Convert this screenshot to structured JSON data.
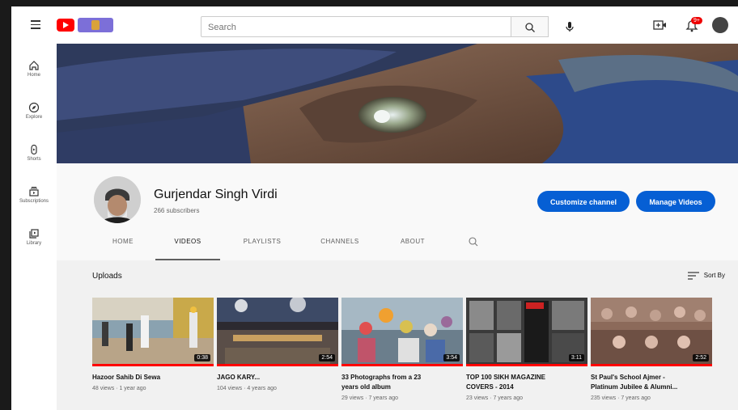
{
  "topbar": {
    "search_placeholder": "Search",
    "notification_count": "9+"
  },
  "sidebar": {
    "items": [
      {
        "label": "Home",
        "icon": "home-icon"
      },
      {
        "label": "Explore",
        "icon": "compass-icon"
      },
      {
        "label": "Shorts",
        "icon": "shorts-icon"
      },
      {
        "label": "Subscriptions",
        "icon": "subscriptions-icon"
      },
      {
        "label": "Library",
        "icon": "library-icon"
      }
    ]
  },
  "channel": {
    "name": "Gurjendar Singh Virdi",
    "subscribers": "266 subscribers",
    "customize_label": "Customize channel",
    "manage_label": "Manage Videos"
  },
  "tabs": [
    {
      "label": "HOME",
      "active": false
    },
    {
      "label": "VIDEOS",
      "active": true
    },
    {
      "label": "PLAYLISTS",
      "active": false
    },
    {
      "label": "CHANNELS",
      "active": false
    },
    {
      "label": "ABOUT",
      "active": false
    }
  ],
  "content": {
    "section_title": "Uploads",
    "sort_label": "Sort By"
  },
  "videos": [
    {
      "title": "Hazoor Sahib Di Sewa",
      "meta": "48 views · 1 year ago",
      "duration": "0:38"
    },
    {
      "title": "JAGO KARY...",
      "meta": "104 views · 4 years ago",
      "duration": "2:54"
    },
    {
      "title": "33 Photographs from a 23",
      "title2": "years old album",
      "meta": "29 views · 7 years ago",
      "duration": "3:54"
    },
    {
      "title": "TOP 100 SIKH MAGAZINE",
      "title2": "COVERS - 2014",
      "meta": "23 views · 7 years ago",
      "duration": "3:11"
    },
    {
      "title": "St Paul's School Ajmer -",
      "title2": "Platinum Jubilee & Alumni...",
      "meta": "235 views · 7 years ago",
      "duration": "2:52"
    }
  ],
  "colors": {
    "accent": "#065fd4",
    "brand_red": "#ff0000"
  }
}
